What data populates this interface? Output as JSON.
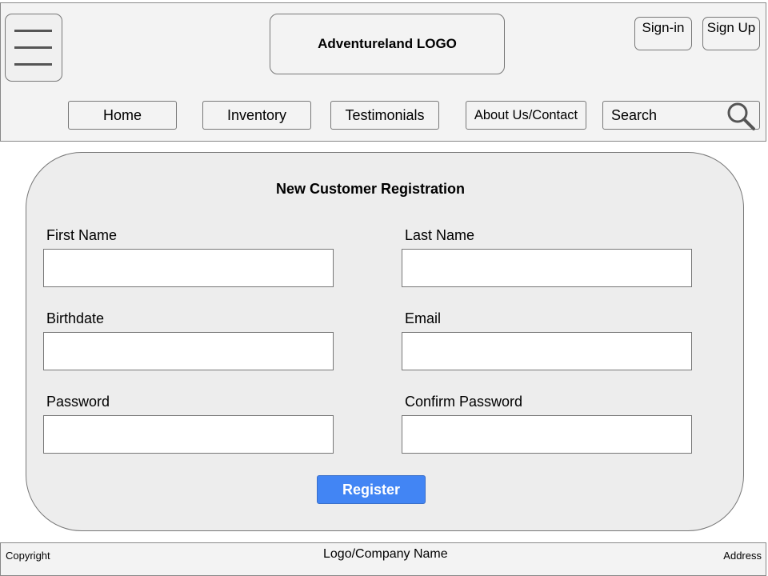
{
  "header": {
    "logo_text": "Adventureland LOGO",
    "menu_icon": "hamburger-menu-icon",
    "sign_in_label": "Sign-in",
    "sign_up_label": "Sign Up"
  },
  "nav": {
    "items": [
      {
        "label": "Home"
      },
      {
        "label": "Inventory"
      },
      {
        "label": "Testimonials"
      },
      {
        "label": "About Us/Contact"
      }
    ],
    "search_text": "Search",
    "search_icon": "search-icon"
  },
  "form": {
    "title": "New Customer Registration",
    "fields": {
      "first_name": {
        "label": "First Name",
        "value": ""
      },
      "last_name": {
        "label": "Last Name",
        "value": ""
      },
      "birthdate": {
        "label": "Birthdate",
        "value": ""
      },
      "email": {
        "label": "Email",
        "value": ""
      },
      "password": {
        "label": "Password",
        "value": ""
      },
      "confirm_password": {
        "label": "Confirm Password",
        "value": ""
      }
    },
    "submit_label": "Register",
    "submit_color": "#4285f4"
  },
  "footer": {
    "left": "Copyright",
    "center": "Logo/Company Name",
    "right": "Address"
  }
}
